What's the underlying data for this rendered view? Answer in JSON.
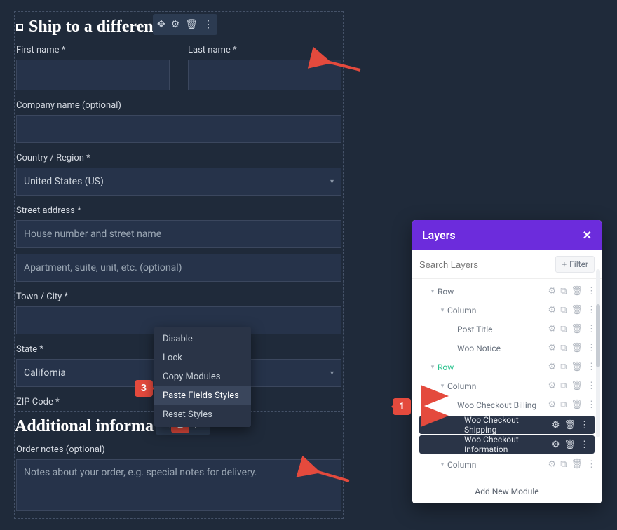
{
  "shipping": {
    "title": "Ship to a different ?",
    "fields": {
      "first_name": "First name *",
      "last_name": "Last name *",
      "company": "Company name (optional)",
      "country": "Country / Region *",
      "country_value": "United States (US)",
      "street": "Street address *",
      "street_ph1": "House number and street name",
      "street_ph2": "Apartment, suite, unit, etc. (optional)",
      "city": "Town / City *",
      "state": "State *",
      "state_value": "California",
      "zip": "ZIP Code *"
    }
  },
  "additional": {
    "title": "Additional informa",
    "notes_label": "Order notes (optional)",
    "notes_ph": "Notes about your order, e.g. special notes for delivery."
  },
  "context_menu": {
    "items": [
      {
        "label": "Disable"
      },
      {
        "label": "Lock"
      },
      {
        "label": "Copy Modules"
      },
      {
        "label": "Paste Fields Styles",
        "active": true
      },
      {
        "label": "Reset Styles"
      }
    ]
  },
  "layers": {
    "title": "Layers",
    "search_ph": "Search Layers",
    "filter": "Filter",
    "add_module": "Add New Module",
    "rows": [
      {
        "depth": 1,
        "label": "Row",
        "caret": true,
        "icons": [
          "gear",
          "dup",
          "trash",
          "dots"
        ],
        "cls": ""
      },
      {
        "depth": 2,
        "label": "Column",
        "caret": true,
        "icons": [
          "gear",
          "dup",
          "trash",
          "dots"
        ],
        "cls": ""
      },
      {
        "depth": 3,
        "label": "Post Title",
        "caret": false,
        "icons": [
          "gear",
          "dup",
          "trash",
          "dots"
        ],
        "cls": ""
      },
      {
        "depth": 3,
        "label": "Woo Notice",
        "caret": false,
        "icons": [
          "gear",
          "dup",
          "trash",
          "dots"
        ],
        "cls": ""
      },
      {
        "depth": 1,
        "label": "Row",
        "caret": true,
        "icons": [
          "gear",
          "dup",
          "trash",
          "dots"
        ],
        "cls": "active-green"
      },
      {
        "depth": 2,
        "label": "Column",
        "caret": true,
        "icons": [
          "gear",
          "dup",
          "trash",
          "dots"
        ],
        "cls": ""
      },
      {
        "depth": 3,
        "label": "Woo Checkout Billing",
        "caret": false,
        "icons": [
          "gear",
          "dup",
          "trash",
          "dots"
        ],
        "cls": ""
      },
      {
        "depth": 3,
        "label": "Woo Checkout Shipping",
        "caret": false,
        "icons": [
          "gear",
          "trash",
          "dots"
        ],
        "cls": "selected"
      },
      {
        "depth": 3,
        "label": "Woo Checkout Information",
        "caret": false,
        "icons": [
          "gear",
          "trash",
          "dots"
        ],
        "cls": "selected"
      },
      {
        "depth": 2,
        "label": "Column",
        "caret": true,
        "icons": [
          "gear",
          "dup",
          "trash",
          "dots"
        ],
        "cls": ""
      }
    ]
  },
  "markers": {
    "m1": "1",
    "m2": "2",
    "m3": "3"
  }
}
